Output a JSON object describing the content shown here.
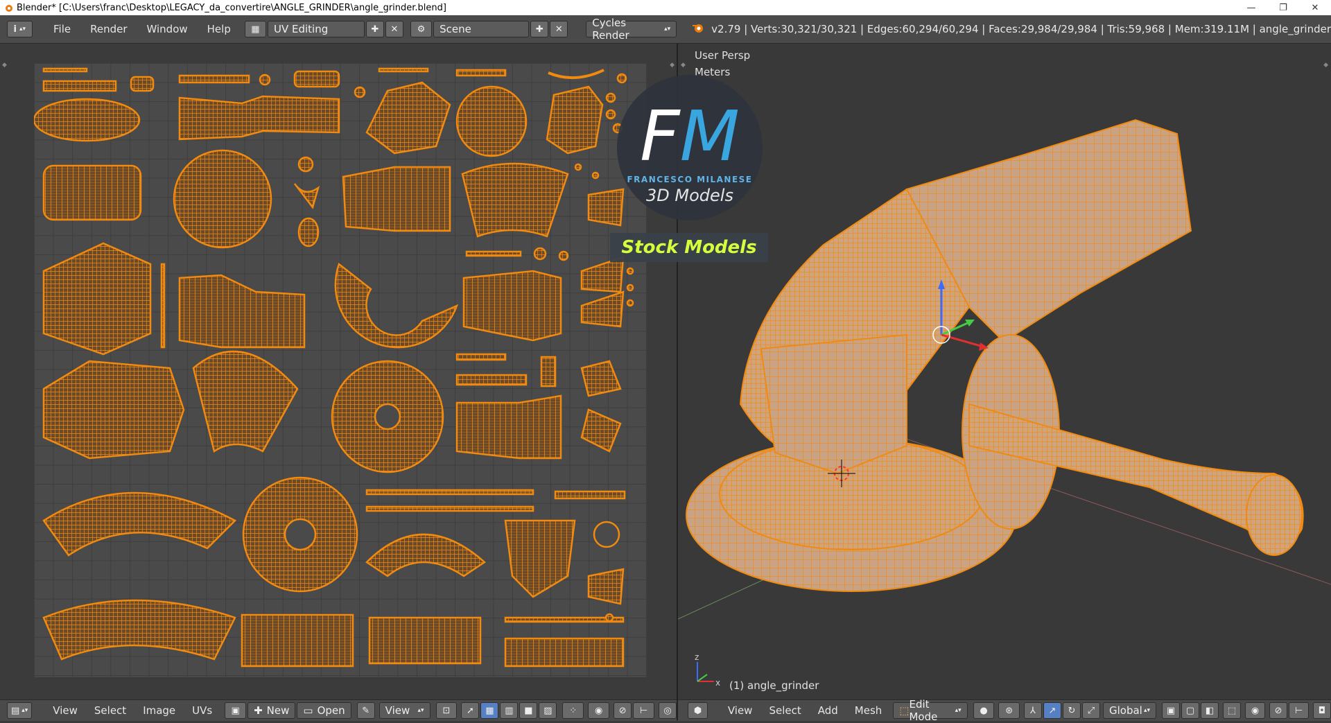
{
  "titlebar": {
    "title": "Blender* [C:\\Users\\franc\\Desktop\\LEGACY_da_convertire\\ANGLE_GRINDER\\angle_grinder.blend]",
    "minimize": "—",
    "maximize": "❐",
    "close": "✕"
  },
  "topbar": {
    "info_icon": "i",
    "menus": [
      "File",
      "Render",
      "Window",
      "Help"
    ],
    "layout": "UV Editing",
    "scene": "Scene",
    "engine": "Cycles Render",
    "stats": "v2.79 | Verts:30,321/30,321 | Edges:60,294/60,294 | Faces:29,984/29,984 | Tris:59,968 | Mem:319.11M | angle_grinder"
  },
  "viewport": {
    "view_label": "User Persp",
    "units_label": "Meters",
    "object_label": "(1) angle_grinder",
    "axis_z": "z",
    "axis_x": "x"
  },
  "footer_left": {
    "menus": [
      "View",
      "Select",
      "Image",
      "UVs"
    ],
    "new_label": "New",
    "open_label": "Open",
    "view_label": "View"
  },
  "footer_right": {
    "menus": [
      "View",
      "Select",
      "Add",
      "Mesh"
    ],
    "mode": "Edit Mode",
    "orientation": "Global"
  },
  "watermark": {
    "logo_f": "F",
    "logo_m": "M",
    "name": "FRANCESCO MILANESE",
    "subtitle": "3D Models",
    "banner": "Stock Models"
  },
  "colors": {
    "uv_orange": "#e5790f",
    "mesh_orange": "#f08a10",
    "mesh_fill": "#c9a383",
    "logo_white": "#ffffff",
    "logo_blue": "#3aa6e0",
    "banner_green": "#d4ff3c"
  }
}
